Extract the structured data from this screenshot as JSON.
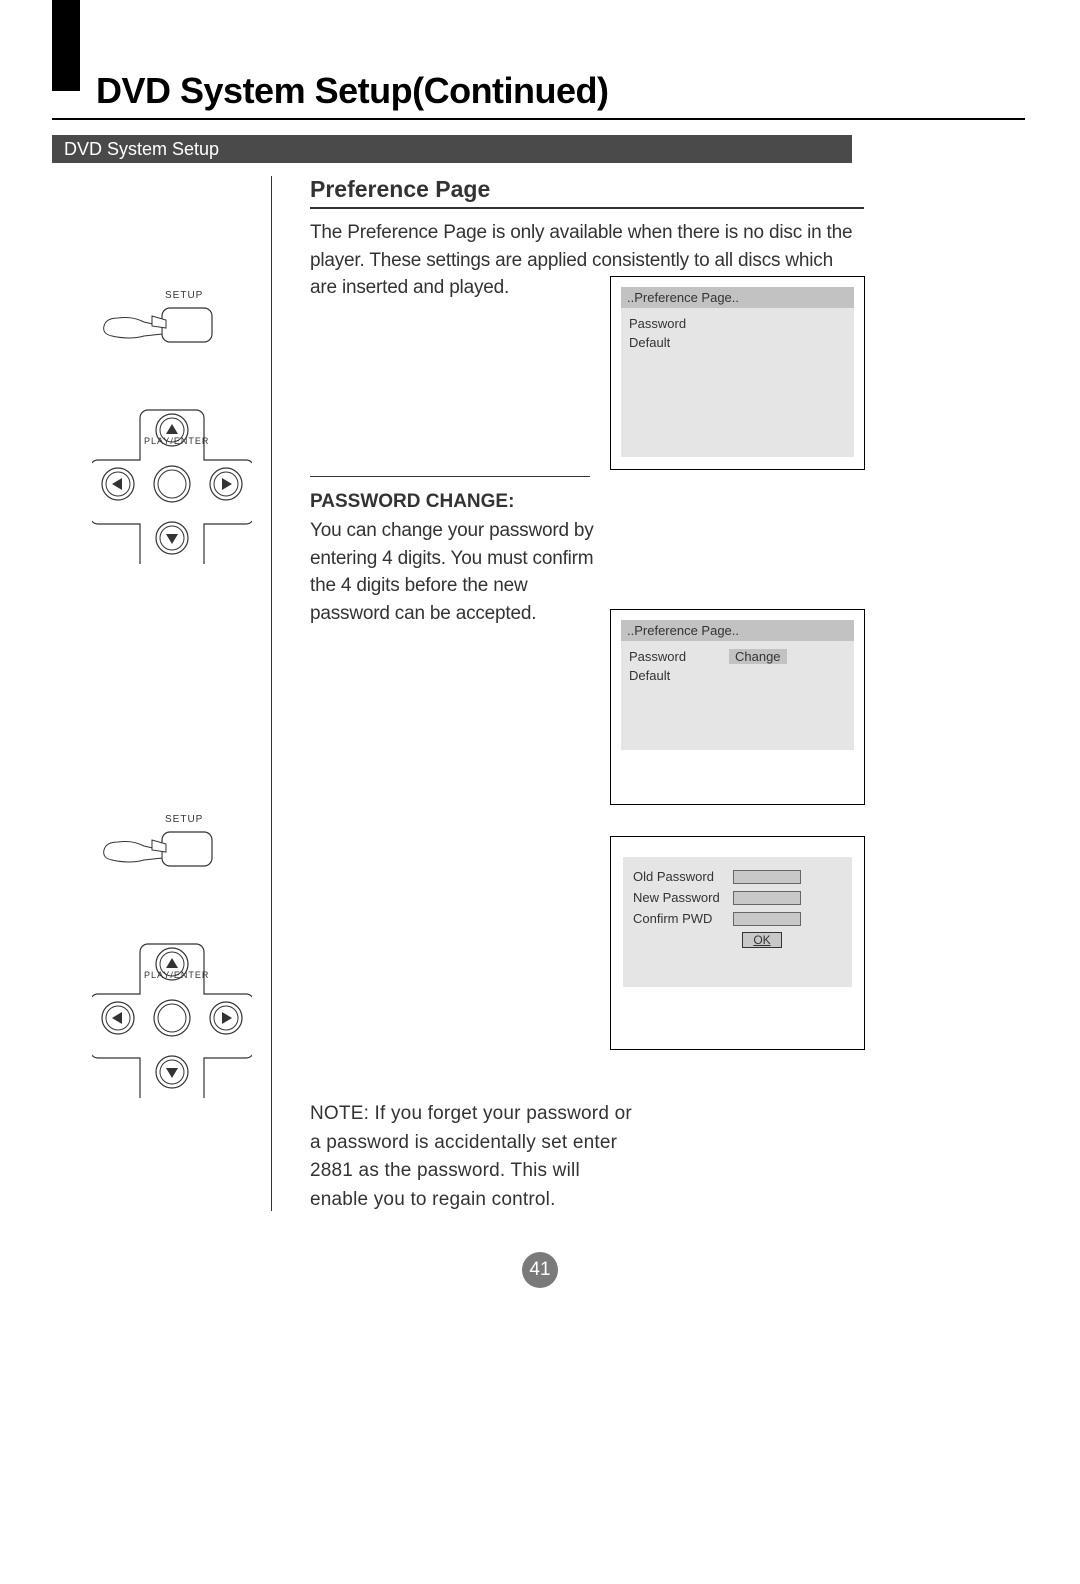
{
  "page": {
    "title": "DVD System Setup(Continued)",
    "section_bar": "DVD System Setup",
    "page_number": "41"
  },
  "preference": {
    "heading": "Preference Page",
    "body": "The Preference Page is only available when there is no disc in the player. These settings are applied consistently to all discs which are inserted and played."
  },
  "osd1": {
    "titlebar": "..Preference Page..",
    "item1": "Password",
    "item2": "Default"
  },
  "password": {
    "heading": "PASSWORD CHANGE:",
    "body": "You can change your password by entering 4 digits. You must confirm the 4 digits before the new password can be accepted."
  },
  "osd2": {
    "titlebar": "..Preference Page..",
    "row1_label": "Password",
    "row1_value": "Change",
    "item2": "Default"
  },
  "osd3": {
    "old": "Old Password",
    "new": "New Password",
    "confirm": "Confirm PWD",
    "ok": "OK"
  },
  "remote": {
    "setup_label": "SETUP",
    "dpad_label": "PLAY/ENTER"
  },
  "note": {
    "text": "NOTE: If you forget your password or a password is accidentally set enter 2881 as the password. This will enable you to regain control."
  }
}
